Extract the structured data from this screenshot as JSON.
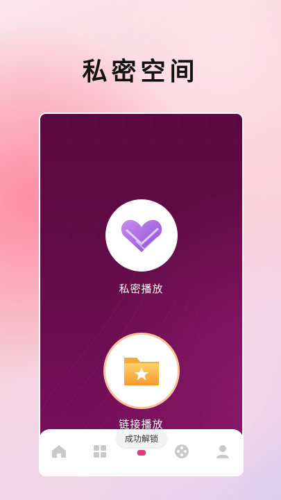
{
  "page": {
    "title": "私密空间"
  },
  "features": {
    "private_play": {
      "label": "私密播放",
      "icon": "heart-box-icon"
    },
    "link_play": {
      "label": "链接播放",
      "icon": "star-folder-icon"
    }
  },
  "toast": {
    "text": "成功解锁"
  },
  "tabbar": {
    "tabs": [
      {
        "icon": "home-icon"
      },
      {
        "icon": "grid-icon"
      },
      {
        "icon": "center-icon"
      },
      {
        "icon": "game-icon"
      },
      {
        "icon": "profile-icon"
      }
    ]
  },
  "colors": {
    "card_bg": "#620b46",
    "accent": "#e03a7d",
    "tab_icon": "#c9c9cc"
  }
}
